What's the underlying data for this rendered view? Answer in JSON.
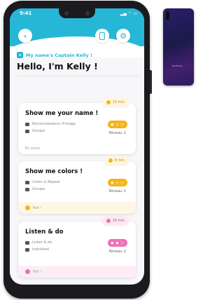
{
  "status_bar": {
    "time": "9:41",
    "icons": "▂▄ ⌔ ▭"
  },
  "header": {
    "back_icon": "chevron-left-icon",
    "device_icon": "phone-icon",
    "settings_icon": "gear-icon"
  },
  "subtitle": "My name's Captain Kelly !",
  "title": "Hello, I'm Kelly !",
  "cards": [
    {
      "title": "Show me your name !",
      "duration": "10 min",
      "meta1": "Reconnaissance d'image",
      "meta2": "Groupe",
      "level": "Niveau 1",
      "stars": "★☆☆",
      "footer": "En cours",
      "accent": "#f3b51b",
      "foot_bg": "#ffffff"
    },
    {
      "title": "Show me colors !",
      "duration": "8 min",
      "meta1": "Listen & Repeat",
      "meta2": "Groupe",
      "level": "Niveau 1",
      "stars": "★☆☆",
      "footer": "Fait !",
      "accent": "#f3b51b",
      "foot_bg": "#fff7e3"
    },
    {
      "title": "Listen & do",
      "duration": "10 min",
      "meta1": "Listen & do",
      "meta2": "Individuel",
      "level": "Niveau 2",
      "stars": "★★☆",
      "footer": "Fait !",
      "accent": "#ee6fb5",
      "foot_bg": "#fdeef6"
    }
  ],
  "second_phone": {
    "label": "Mo Phone"
  }
}
